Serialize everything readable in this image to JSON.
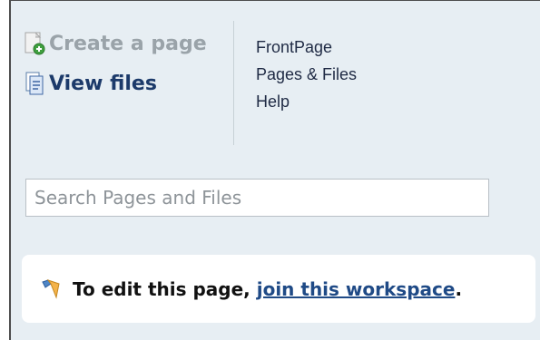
{
  "actions": {
    "create_page": "Create a page",
    "view_files": "View files"
  },
  "nav_links": [
    "FrontPage",
    "Pages & Files",
    "Help"
  ],
  "search": {
    "placeholder": "Search Pages and Files"
  },
  "notice": {
    "prefix": "To edit this page, ",
    "link": "join this workspace",
    "suffix": "."
  }
}
